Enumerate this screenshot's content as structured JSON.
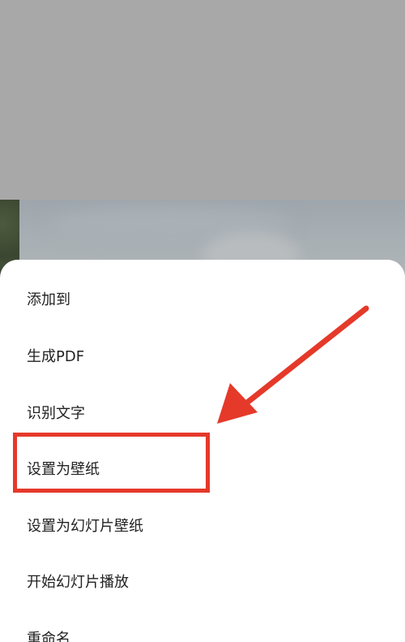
{
  "menu": {
    "items": [
      {
        "label": "添加到"
      },
      {
        "label": "生成PDF"
      },
      {
        "label": "识别文字"
      },
      {
        "label": "设置为壁纸"
      },
      {
        "label": "设置为幻灯片壁纸"
      },
      {
        "label": "开始幻灯片播放"
      },
      {
        "label": "重命名"
      }
    ],
    "highlighted_index": 3
  },
  "annotation": {
    "highlight_color": "#e5392a",
    "arrow_color": "#e5392a"
  }
}
